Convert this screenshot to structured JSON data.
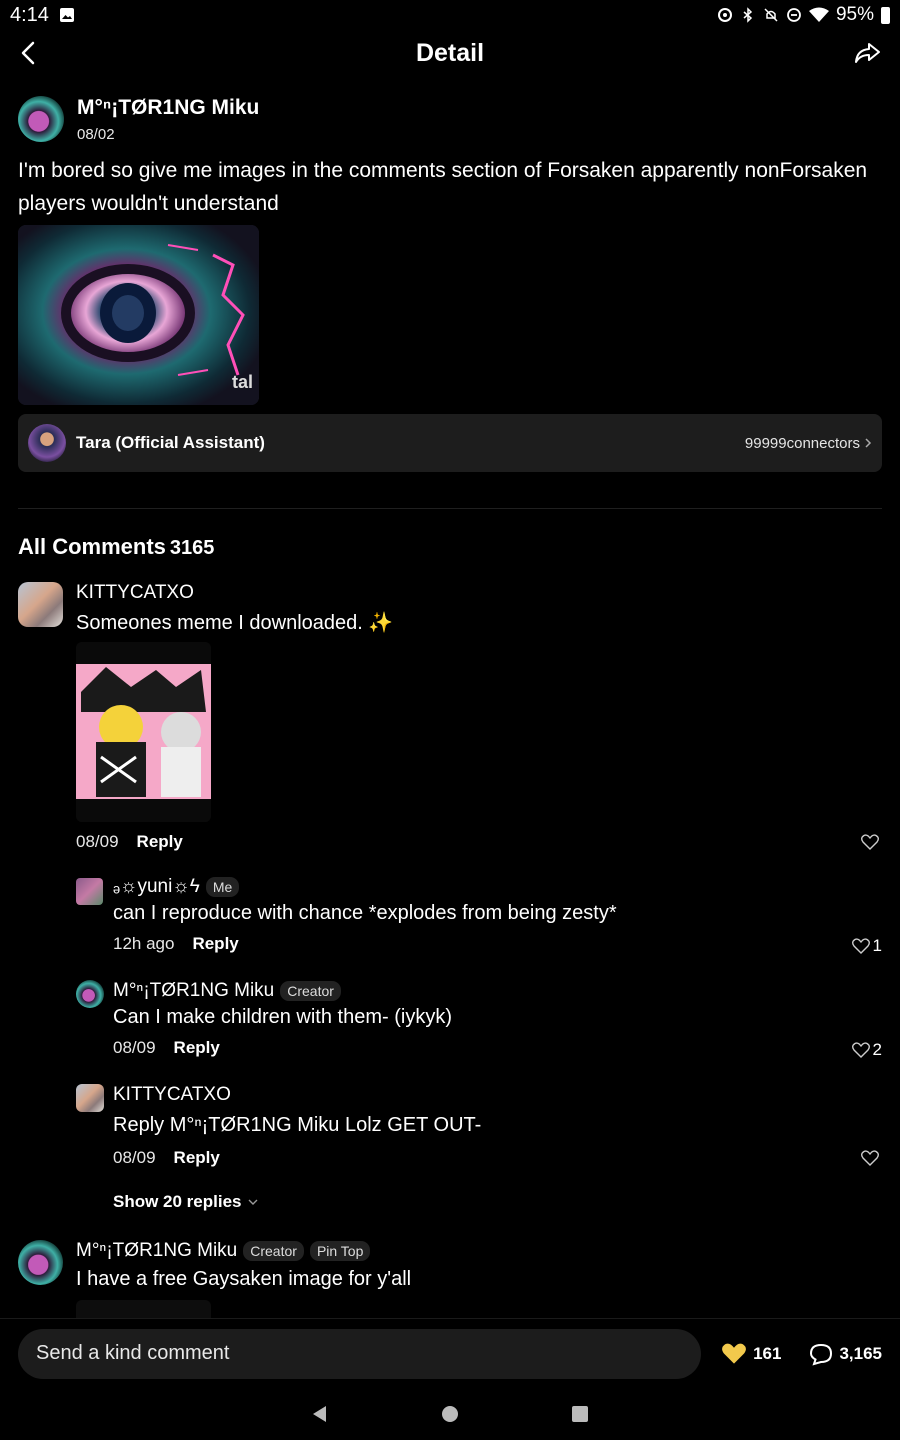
{
  "status_bar": {
    "time": "4:14",
    "battery": "95%"
  },
  "header": {
    "title": "Detail"
  },
  "post": {
    "author": "M°ⁿ¡TØR1NG Miku",
    "date": "08/02",
    "text": "I'm bored so give me images in the comments section of Forsaken apparently nonForsaken players wouldn't understand",
    "image_watermark": "tal"
  },
  "assistant": {
    "name": "Tara (Official Assistant)",
    "link": "99999connectors"
  },
  "comments": {
    "title": "All Comments",
    "count": "3165",
    "items": [
      {
        "author": "KITTYCATXO",
        "text": "Someones meme I downloaded. ✨",
        "date": "08/09",
        "reply_label": "Reply",
        "likes": ""
      },
      {
        "author": "ₔ☼yuni☼ϟ",
        "badge": "Me",
        "text": "can I reproduce with chance *explodes from being zesty*",
        "date": "12h ago",
        "reply_label": "Reply",
        "likes": "1"
      },
      {
        "author": "M°ⁿ¡TØR1NG Miku",
        "badge": "Creator",
        "text": "Can I make children with them- (iykyk)",
        "date": "08/09",
        "reply_label": "Reply",
        "likes": "2"
      },
      {
        "author": "KITTYCATXO",
        "text": "Reply M°ⁿ¡TØR1NG Miku Lolz GET OUT-",
        "date": "08/09",
        "reply_label": "Reply",
        "likes": ""
      },
      {
        "author": "M°ⁿ¡TØR1NG Miku",
        "badge": "Creator",
        "badge2": "Pin Top",
        "text": "I have a free Gaysaken image for y'all"
      }
    ],
    "show_replies": "Show 20 replies"
  },
  "bottom_bar": {
    "placeholder": "Send a kind comment",
    "likes": "161",
    "comments": "3,165"
  },
  "colors": {
    "background": "#000000",
    "card": "#1d1d1d",
    "heart_filled": "#f2c94c"
  }
}
